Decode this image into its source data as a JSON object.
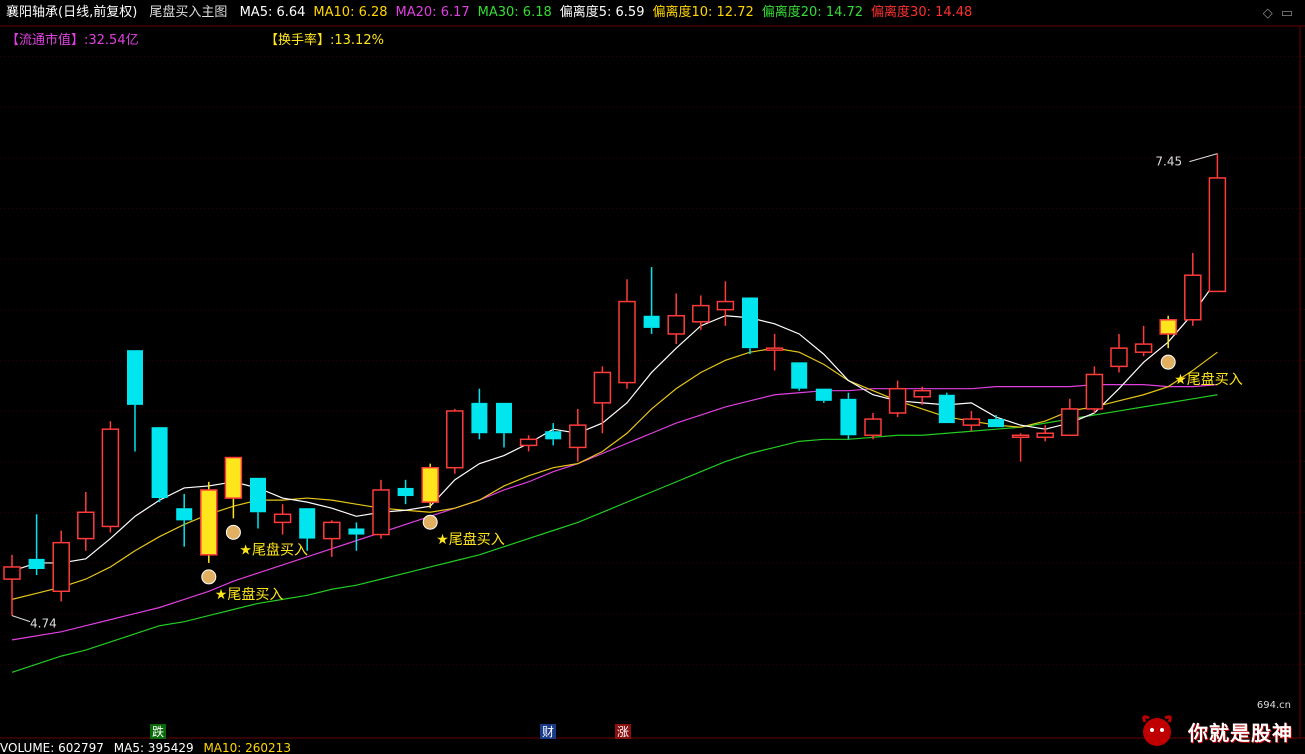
{
  "header": {
    "stock_title": "襄阳轴承(日线,前复权)",
    "indicator_name": "尾盘买入主图",
    "items": [
      {
        "label": "MA5: 6.64",
        "color": "#ffffff"
      },
      {
        "label": "MA10: 6.28",
        "color": "#ffd700"
      },
      {
        "label": "MA20: 6.17",
        "color": "#e040e0"
      },
      {
        "label": "MA30: 6.18",
        "color": "#33dd33"
      },
      {
        "label": "偏离度5: 6.59",
        "color": "#ffffff"
      },
      {
        "label": "偏离度10: 12.72",
        "color": "#ffd700"
      },
      {
        "label": "偏离度20: 14.72",
        "color": "#33dd33"
      },
      {
        "label": "偏离度30: 14.48",
        "color": "#ff3030"
      }
    ]
  },
  "sub_header": {
    "market_cap": "【流通市值】:32.54亿",
    "turnover": "【换手率】:13.12%"
  },
  "volume_bar": {
    "volume": "VOLUME: 602797",
    "ma5": "MA5: 395429",
    "ma10": "MA10: 260213"
  },
  "markers": {
    "die": "跌",
    "cai": "财",
    "zhang": "涨"
  },
  "watermark": {
    "site": "694.cn",
    "text": "你就是股神"
  },
  "colors": {
    "up": "#ff3b3b",
    "down": "#00e5ee",
    "signal": "#ffe61c",
    "ma5": "#ffffff",
    "ma10": "#e6c619",
    "ma20": "#e040e0",
    "ma30": "#22cc22"
  },
  "chart_data": {
    "type": "candlestick",
    "ylim": [
      4.2,
      7.65
    ],
    "price_labels": {
      "max": "7.45",
      "min": "4.74"
    },
    "signal_label": "★尾盘买入",
    "candles": [
      {
        "o": 4.92,
        "h": 5.04,
        "l": 4.74,
        "c": 4.98,
        "signal": false
      },
      {
        "o": 5.02,
        "h": 5.24,
        "l": 4.94,
        "c": 4.97,
        "signal": false
      },
      {
        "o": 4.86,
        "h": 5.16,
        "l": 4.81,
        "c": 5.1,
        "signal": false
      },
      {
        "o": 5.12,
        "h": 5.35,
        "l": 5.06,
        "c": 5.25,
        "signal": false
      },
      {
        "o": 5.18,
        "h": 5.7,
        "l": 5.15,
        "c": 5.66,
        "signal": false
      },
      {
        "o": 6.05,
        "h": 6.05,
        "l": 5.55,
        "c": 5.78,
        "signal": false
      },
      {
        "o": 5.67,
        "h": 5.67,
        "l": 5.3,
        "c": 5.32,
        "signal": false
      },
      {
        "o": 5.27,
        "h": 5.34,
        "l": 5.08,
        "c": 5.21,
        "signal": false
      },
      {
        "o": 5.04,
        "h": 5.4,
        "l": 5.0,
        "c": 5.36,
        "signal": true
      },
      {
        "o": 5.32,
        "h": 5.52,
        "l": 5.22,
        "c": 5.52,
        "signal": true
      },
      {
        "o": 5.42,
        "h": 5.42,
        "l": 5.17,
        "c": 5.25,
        "signal": false
      },
      {
        "o": 5.2,
        "h": 5.29,
        "l": 5.14,
        "c": 5.24,
        "signal": false
      },
      {
        "o": 5.27,
        "h": 5.27,
        "l": 5.06,
        "c": 5.12,
        "signal": false
      },
      {
        "o": 5.12,
        "h": 5.21,
        "l": 5.03,
        "c": 5.2,
        "signal": false
      },
      {
        "o": 5.17,
        "h": 5.2,
        "l": 5.06,
        "c": 5.14,
        "signal": false
      },
      {
        "o": 5.14,
        "h": 5.41,
        "l": 5.12,
        "c": 5.36,
        "signal": false
      },
      {
        "o": 5.37,
        "h": 5.41,
        "l": 5.29,
        "c": 5.33,
        "signal": false
      },
      {
        "o": 5.3,
        "h": 5.49,
        "l": 5.27,
        "c": 5.47,
        "signal": true
      },
      {
        "o": 5.47,
        "h": 5.76,
        "l": 5.44,
        "c": 5.75,
        "signal": false
      },
      {
        "o": 5.79,
        "h": 5.86,
        "l": 5.61,
        "c": 5.64,
        "signal": false
      },
      {
        "o": 5.79,
        "h": 5.79,
        "l": 5.57,
        "c": 5.64,
        "signal": false
      },
      {
        "o": 5.58,
        "h": 5.63,
        "l": 5.55,
        "c": 5.61,
        "signal": false
      },
      {
        "o": 5.65,
        "h": 5.69,
        "l": 5.58,
        "c": 5.61,
        "signal": false
      },
      {
        "o": 5.57,
        "h": 5.76,
        "l": 5.5,
        "c": 5.68,
        "signal": false
      },
      {
        "o": 5.79,
        "h": 5.97,
        "l": 5.64,
        "c": 5.94,
        "signal": false
      },
      {
        "o": 5.89,
        "h": 6.4,
        "l": 5.86,
        "c": 6.29,
        "signal": false
      },
      {
        "o": 6.22,
        "h": 6.46,
        "l": 6.13,
        "c": 6.16,
        "signal": false
      },
      {
        "o": 6.13,
        "h": 6.33,
        "l": 6.08,
        "c": 6.22,
        "signal": false
      },
      {
        "o": 6.19,
        "h": 6.32,
        "l": 6.15,
        "c": 6.27,
        "signal": false
      },
      {
        "o": 6.25,
        "h": 6.39,
        "l": 6.17,
        "c": 6.29,
        "signal": false
      },
      {
        "o": 6.31,
        "h": 6.31,
        "l": 6.03,
        "c": 6.06,
        "signal": false
      },
      {
        "o": 6.06,
        "h": 6.13,
        "l": 5.95,
        "c": 6.06,
        "signal": false
      },
      {
        "o": 5.99,
        "h": 5.99,
        "l": 5.85,
        "c": 5.86,
        "signal": false
      },
      {
        "o": 5.86,
        "h": 5.86,
        "l": 5.79,
        "c": 5.8,
        "signal": false
      },
      {
        "o": 5.81,
        "h": 5.84,
        "l": 5.61,
        "c": 5.63,
        "signal": false
      },
      {
        "o": 5.63,
        "h": 5.74,
        "l": 5.61,
        "c": 5.71,
        "signal": false
      },
      {
        "o": 5.74,
        "h": 5.9,
        "l": 5.72,
        "c": 5.86,
        "signal": false
      },
      {
        "o": 5.82,
        "h": 5.87,
        "l": 5.78,
        "c": 5.85,
        "signal": false
      },
      {
        "o": 5.83,
        "h": 5.84,
        "l": 5.69,
        "c": 5.69,
        "signal": false
      },
      {
        "o": 5.68,
        "h": 5.75,
        "l": 5.65,
        "c": 5.71,
        "signal": false
      },
      {
        "o": 5.71,
        "h": 5.73,
        "l": 5.67,
        "c": 5.67,
        "signal": false
      },
      {
        "o": 5.63,
        "h": 5.64,
        "l": 5.5,
        "c": 5.63,
        "signal": false
      },
      {
        "o": 5.62,
        "h": 5.68,
        "l": 5.6,
        "c": 5.64,
        "signal": false
      },
      {
        "o": 5.63,
        "h": 5.81,
        "l": 5.63,
        "c": 5.76,
        "signal": false
      },
      {
        "o": 5.76,
        "h": 5.97,
        "l": 5.74,
        "c": 5.93,
        "signal": false
      },
      {
        "o": 5.97,
        "h": 6.13,
        "l": 5.94,
        "c": 6.06,
        "signal": false
      },
      {
        "o": 6.04,
        "h": 6.17,
        "l": 6.02,
        "c": 6.08,
        "signal": false
      },
      {
        "o": 6.13,
        "h": 6.22,
        "l": 6.06,
        "c": 6.2,
        "signal": true
      },
      {
        "o": 6.2,
        "h": 6.53,
        "l": 6.17,
        "c": 6.42,
        "signal": false
      },
      {
        "o": 6.34,
        "h": 7.02,
        "l": 6.34,
        "c": 6.9,
        "signal": false
      }
    ],
    "ma5": [
      4.96,
      5.0,
      5.0,
      5.02,
      5.12,
      5.23,
      5.31,
      5.37,
      5.38,
      5.4,
      5.37,
      5.32,
      5.3,
      5.27,
      5.23,
      5.25,
      5.26,
      5.28,
      5.41,
      5.49,
      5.53,
      5.59,
      5.66,
      5.64,
      5.69,
      5.79,
      5.94,
      6.06,
      6.17,
      6.22,
      6.21,
      6.18,
      6.13,
      6.03,
      5.9,
      5.83,
      5.8,
      5.79,
      5.78,
      5.79,
      5.72,
      5.68,
      5.66,
      5.69,
      5.74,
      5.86,
      5.99,
      6.09,
      6.23,
      6.4
    ],
    "ma10": [
      4.82,
      4.85,
      4.88,
      4.92,
      4.98,
      5.06,
      5.13,
      5.19,
      5.24,
      5.28,
      5.31,
      5.31,
      5.32,
      5.31,
      5.29,
      5.27,
      5.26,
      5.25,
      5.27,
      5.31,
      5.38,
      5.43,
      5.47,
      5.49,
      5.55,
      5.64,
      5.76,
      5.86,
      5.94,
      6.0,
      6.04,
      6.06,
      6.04,
      5.98,
      5.9,
      5.85,
      5.8,
      5.76,
      5.72,
      5.7,
      5.68,
      5.67,
      5.7,
      5.75,
      5.77,
      5.8,
      5.83,
      5.87,
      5.95,
      6.04
    ],
    "ma20": [
      4.62,
      4.64,
      4.66,
      4.69,
      4.72,
      4.75,
      4.78,
      4.82,
      4.86,
      4.91,
      4.95,
      4.99,
      5.03,
      5.07,
      5.11,
      5.15,
      5.19,
      5.23,
      5.27,
      5.31,
      5.36,
      5.4,
      5.45,
      5.49,
      5.54,
      5.59,
      5.64,
      5.69,
      5.73,
      5.77,
      5.8,
      5.83,
      5.84,
      5.85,
      5.85,
      5.86,
      5.86,
      5.86,
      5.86,
      5.86,
      5.87,
      5.87,
      5.87,
      5.87,
      5.88,
      5.88,
      5.88,
      5.87,
      5.87,
      5.88
    ],
    "ma30": [
      4.46,
      4.5,
      4.54,
      4.57,
      4.61,
      4.65,
      4.69,
      4.71,
      4.74,
      4.77,
      4.8,
      4.82,
      4.84,
      4.87,
      4.89,
      4.92,
      4.95,
      4.98,
      5.01,
      5.04,
      5.08,
      5.12,
      5.16,
      5.2,
      5.25,
      5.3,
      5.35,
      5.4,
      5.45,
      5.5,
      5.54,
      5.57,
      5.6,
      5.61,
      5.61,
      5.62,
      5.63,
      5.63,
      5.64,
      5.65,
      5.66,
      5.67,
      5.69,
      5.71,
      5.73,
      5.75,
      5.77,
      5.79,
      5.81,
      5.83
    ]
  }
}
